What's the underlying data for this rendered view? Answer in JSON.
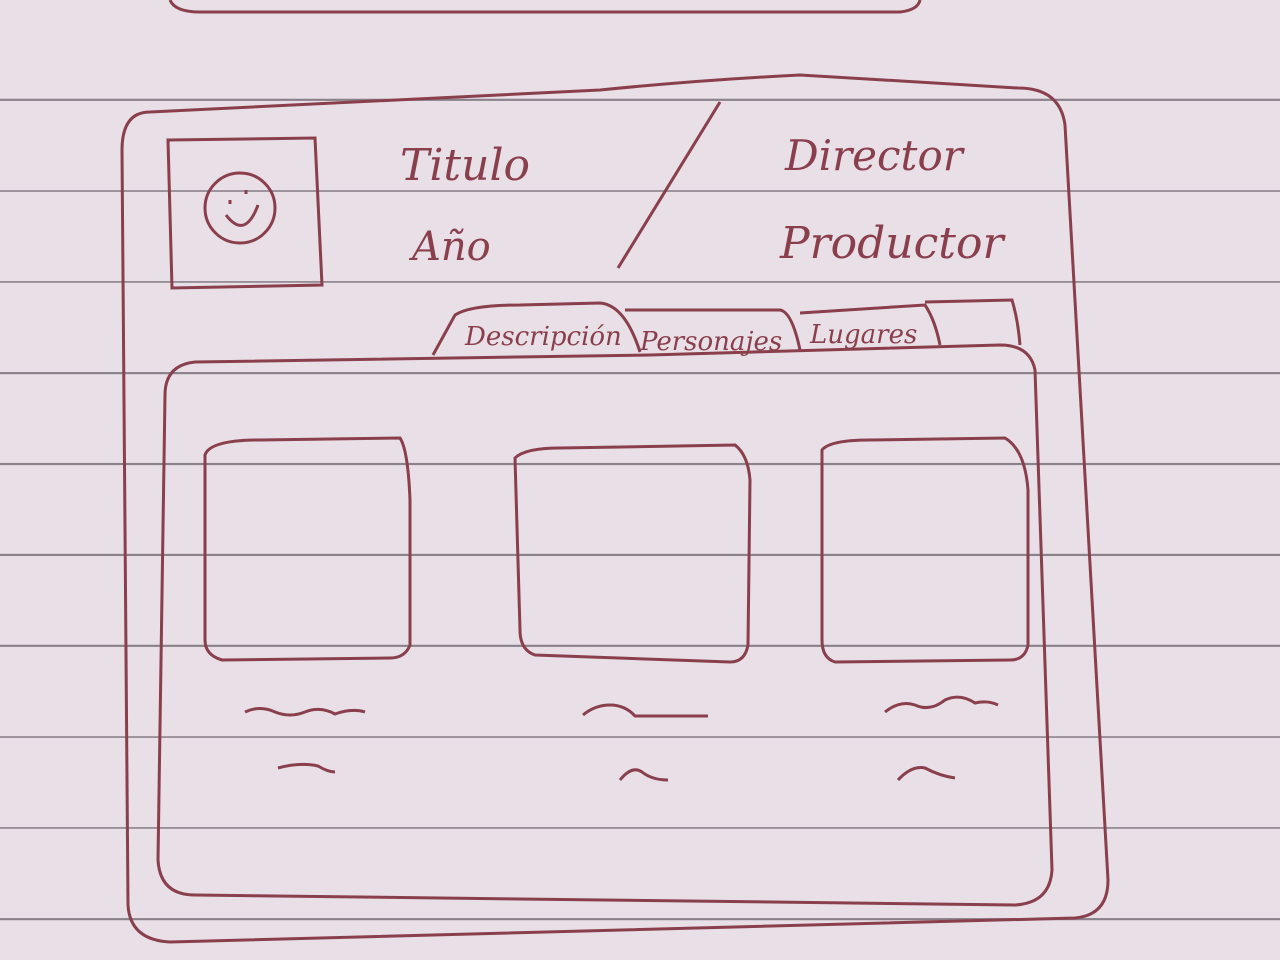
{
  "header": {
    "title_label": "Titulo",
    "year_label": "Año",
    "director_label": "Director",
    "producer_label": "Productor",
    "poster_icon": "smiley-face-icon"
  },
  "tabs": [
    {
      "label": "Descripción"
    },
    {
      "label": "Personajes"
    },
    {
      "label": "Lugares"
    }
  ],
  "cards": [
    {
      "image_icon": "image-placeholder"
    },
    {
      "image_icon": "image-placeholder"
    },
    {
      "image_icon": "image-placeholder"
    }
  ],
  "colors": {
    "ink": "#8a3f4d",
    "paper": "#e9dfe6"
  }
}
